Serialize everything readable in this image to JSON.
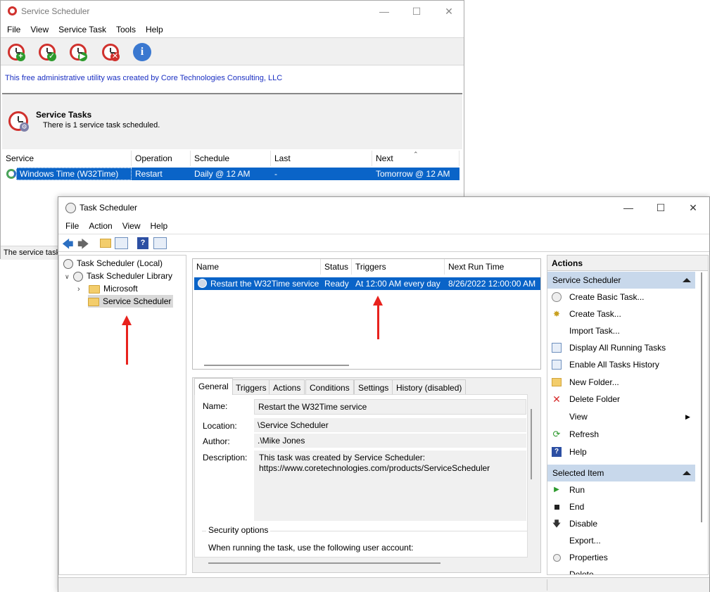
{
  "service_scheduler": {
    "title": "Service Scheduler",
    "menu": [
      "File",
      "View",
      "Service Task",
      "Tools",
      "Help"
    ],
    "toolbar_icons": [
      "add-task-icon",
      "edit-task-icon",
      "run-task-icon",
      "delete-task-icon",
      "info-icon"
    ],
    "banner": "This free administrative utility was created by Core Technologies Consulting, LLC",
    "panel_title": "Service Tasks",
    "panel_subtitle": "There is 1 service task scheduled.",
    "columns": [
      "Service",
      "Operation",
      "Schedule",
      "Last",
      "Next"
    ],
    "rows": [
      {
        "service": "Windows Time (W32Time)",
        "operation": "Restart",
        "schedule": "Daily @ 12 AM",
        "last": "-",
        "next": "Tomorrow @ 12 AM"
      }
    ],
    "status": "The service task"
  },
  "task_scheduler": {
    "title": "Task Scheduler",
    "menu": [
      "File",
      "Action",
      "View",
      "Help"
    ],
    "tree": {
      "root": "Task Scheduler (Local)",
      "library": "Task Scheduler Library",
      "children": [
        "Microsoft",
        "Service Scheduler"
      ]
    },
    "task_columns": [
      "Name",
      "Status",
      "Triggers",
      "Next Run Time"
    ],
    "tasks": [
      {
        "name": "Restart the W32Time service",
        "status": "Ready",
        "triggers": "At 12:00 AM every day",
        "next_run": "8/26/2022 12:00:00 AM"
      }
    ],
    "tabs": [
      "General",
      "Triggers",
      "Actions",
      "Conditions",
      "Settings",
      "History (disabled)"
    ],
    "general": {
      "name_label": "Name:",
      "name_value": "Restart the W32Time service",
      "location_label": "Location:",
      "location_value": "\\Service Scheduler",
      "author_label": "Author:",
      "author_value": ".\\Mike Jones",
      "description_label": "Description:",
      "description_line1": "This task was created by Service Scheduler:",
      "description_line2": "https://www.coretechnologies.com/products/ServiceScheduler",
      "security_title": "Security options",
      "security_text": "When running the task, use the following user account:"
    },
    "actions": {
      "header": "Actions",
      "section1": "Service Scheduler",
      "items1": [
        "Create Basic Task...",
        "Create Task...",
        "Import Task...",
        "Display All Running Tasks",
        "Enable All Tasks History",
        "New Folder...",
        "Delete Folder",
        "View",
        "Refresh",
        "Help"
      ],
      "section2": "Selected Item",
      "items2": [
        "Run",
        "End",
        "Disable",
        "Export...",
        "Properties",
        "Delete"
      ]
    }
  }
}
